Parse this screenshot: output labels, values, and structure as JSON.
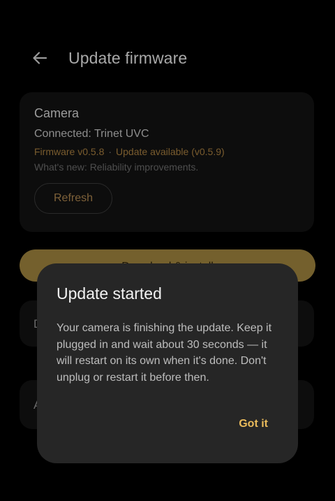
{
  "header": {
    "title": "Update firmware",
    "back_icon": "arrow-left-icon"
  },
  "camera_card": {
    "title": "Camera",
    "connected": "Connected: Trinet UVC",
    "firmware": "Firmware v0.5.8",
    "separator": "·",
    "update_available": "Update available (v0.5.9)",
    "whats_new": "What's new: Reliability improvements.",
    "refresh_label": "Refresh"
  },
  "primary_action": {
    "label": "Download & install"
  },
  "obscured_rows": [
    {
      "initial": "D"
    },
    {
      "initial": "A"
    }
  ],
  "dialog": {
    "title": "Update started",
    "body": "Your camera is finishing the update. Keep it plugged in and wait about 30 seconds — it will restart on its own when it's done. Don't unplug or restart it before then.",
    "confirm_label": "Got it"
  },
  "colors": {
    "accent": "#e9ba5b",
    "dialog_background": "#262626",
    "background": "#000000"
  }
}
